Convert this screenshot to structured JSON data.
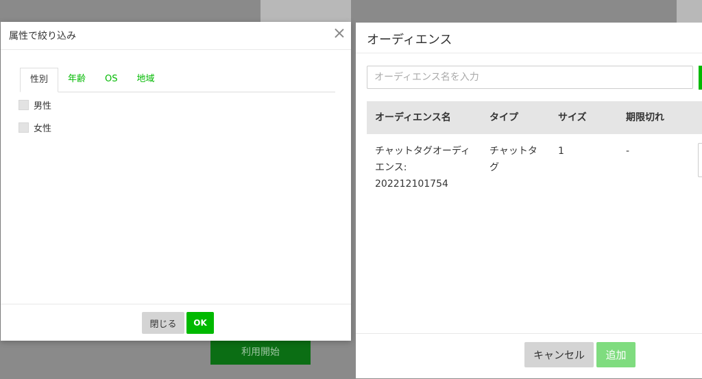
{
  "background": {
    "start_button_label": "利用開始"
  },
  "filter_modal": {
    "title": "属性で絞り込み",
    "tabs": [
      {
        "label": "性別",
        "active": true
      },
      {
        "label": "年齢",
        "active": false
      },
      {
        "label": "OS",
        "active": false
      },
      {
        "label": "地域",
        "active": false
      }
    ],
    "options": [
      {
        "label": "男性",
        "checked": false
      },
      {
        "label": "女性",
        "checked": false
      }
    ],
    "close_label": "閉じる",
    "ok_label": "OK"
  },
  "audience_modal": {
    "title": "オーディエンス",
    "search": {
      "placeholder": "オーディエンス名を入力",
      "value": ""
    },
    "table": {
      "headers": [
        "オーディエンス名",
        "タイプ",
        "サイズ",
        "期限切れ"
      ],
      "rows": [
        {
          "name": "チャットタグオーディエンス: 202212101754",
          "type": "チャットタグ",
          "size": "1",
          "expiry": "-"
        }
      ]
    },
    "cancel_label": "キャンセル",
    "add_label": "追加"
  },
  "colors": {
    "accent": "#00b900",
    "accent_disabled": "#7fdc7f",
    "overlay": "#8a8a8a"
  }
}
